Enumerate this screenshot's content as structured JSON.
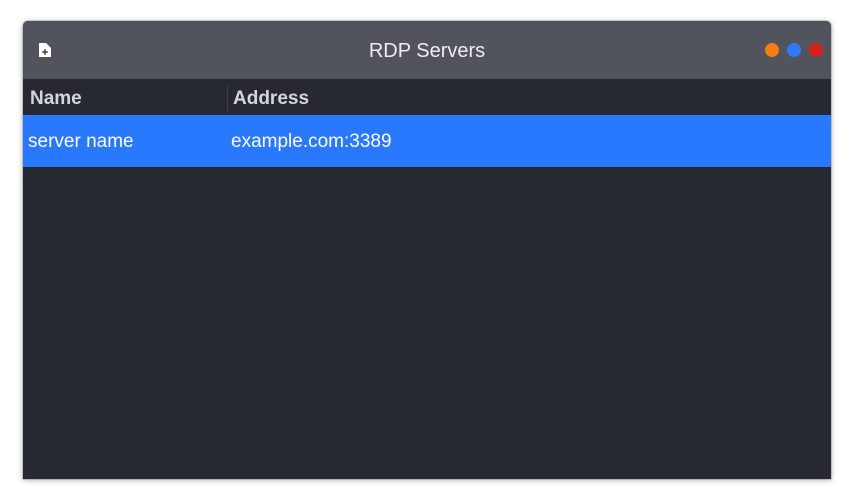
{
  "window": {
    "title": "RDP Servers",
    "controls": [
      "minimize",
      "maximize",
      "close"
    ]
  },
  "toolbar": {
    "new_icon": "new-document-icon"
  },
  "table": {
    "columns": [
      "Name",
      "Address"
    ],
    "rows": [
      {
        "name": "server name",
        "address": "example.com:3389",
        "selected": true
      }
    ]
  },
  "colors": {
    "titlebar": "#51545c",
    "background": "#272932",
    "selection": "#2879fd",
    "minimize": "#fb7c12",
    "maximize": "#3079f4",
    "close": "#d81d1d"
  }
}
